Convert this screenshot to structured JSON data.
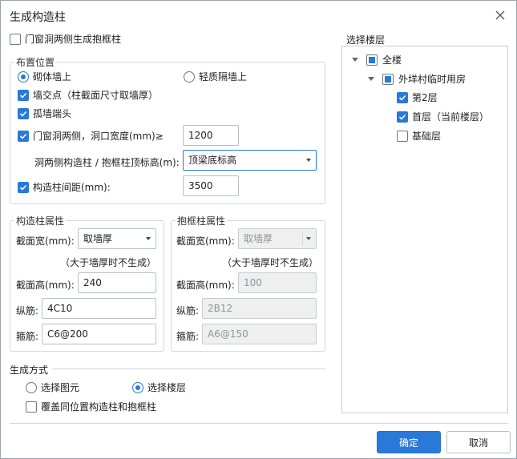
{
  "dialog": {
    "title": "生成构造柱",
    "icons": {
      "close": "close-icon",
      "check": "check-icon",
      "dropdown": "chevron-down-icon",
      "expand": "expand-triangle-icon"
    }
  },
  "top_checkbox": {
    "label": "门窗洞两侧生成抱框柱",
    "checked": false
  },
  "placement": {
    "title": "布置位置",
    "radio_masonry": {
      "label": "砌体墙上",
      "selected": true
    },
    "radio_light": {
      "label": "轻质隔墙上",
      "selected": false
    },
    "wall_intersection": {
      "label": "墙交点（柱截面尺寸取墙厚）",
      "checked": true
    },
    "isolated_wall_end": {
      "label": "孤墙端头",
      "checked": true
    },
    "opening_sides": {
      "label": "门窗洞两侧，洞口宽度(mm)≥",
      "checked": true,
      "value": "1200"
    },
    "top_elevation": {
      "label": "洞两侧构造柱 / 抱框柱顶标高(m):",
      "value": "顶梁底标高"
    },
    "spacing": {
      "label": "构造柱间距(mm):",
      "checked": true,
      "value": "3500"
    }
  },
  "column_props": {
    "title": "构造柱属性",
    "width_label": "截面宽(mm):",
    "width_value": "取墙厚",
    "note": "（大于墙厚时不生成）",
    "height_label": "截面高(mm):",
    "height_value": "240",
    "long_label": "纵筋:",
    "long_value": "4C10",
    "stirrup_label": "箍筋:",
    "stirrup_value": "C6@200"
  },
  "frame_props": {
    "title": "抱框柱属性",
    "width_label": "截面宽(mm):",
    "width_value": "取墙厚",
    "note": "（大于墙厚时不生成）",
    "height_label": "截面高(mm):",
    "height_value": "100",
    "long_label": "纵筋:",
    "long_value": "2B12",
    "stirrup_label": "箍筋:",
    "stirrup_value": "A6@150"
  },
  "gen_method": {
    "title": "生成方式",
    "radio_element": {
      "label": "选择图元",
      "selected": false
    },
    "radio_floor": {
      "label": "选择楼层",
      "selected": true
    },
    "overwrite": {
      "label": "覆盖同位置构造柱和抱框柱",
      "checked": false
    }
  },
  "floor_select": {
    "title": "选择楼层",
    "root": {
      "label": "全楼"
    },
    "project": {
      "label": "外垟村临时用房"
    },
    "floors": [
      {
        "label": "第2层",
        "checked": true
      },
      {
        "label": "首层（当前楼层）",
        "checked": true
      },
      {
        "label": "基础层",
        "checked": false
      }
    ]
  },
  "buttons": {
    "ok": "确定",
    "cancel": "取消"
  },
  "colors": {
    "accent": "#2979d8",
    "border": "#d3d7dc"
  }
}
